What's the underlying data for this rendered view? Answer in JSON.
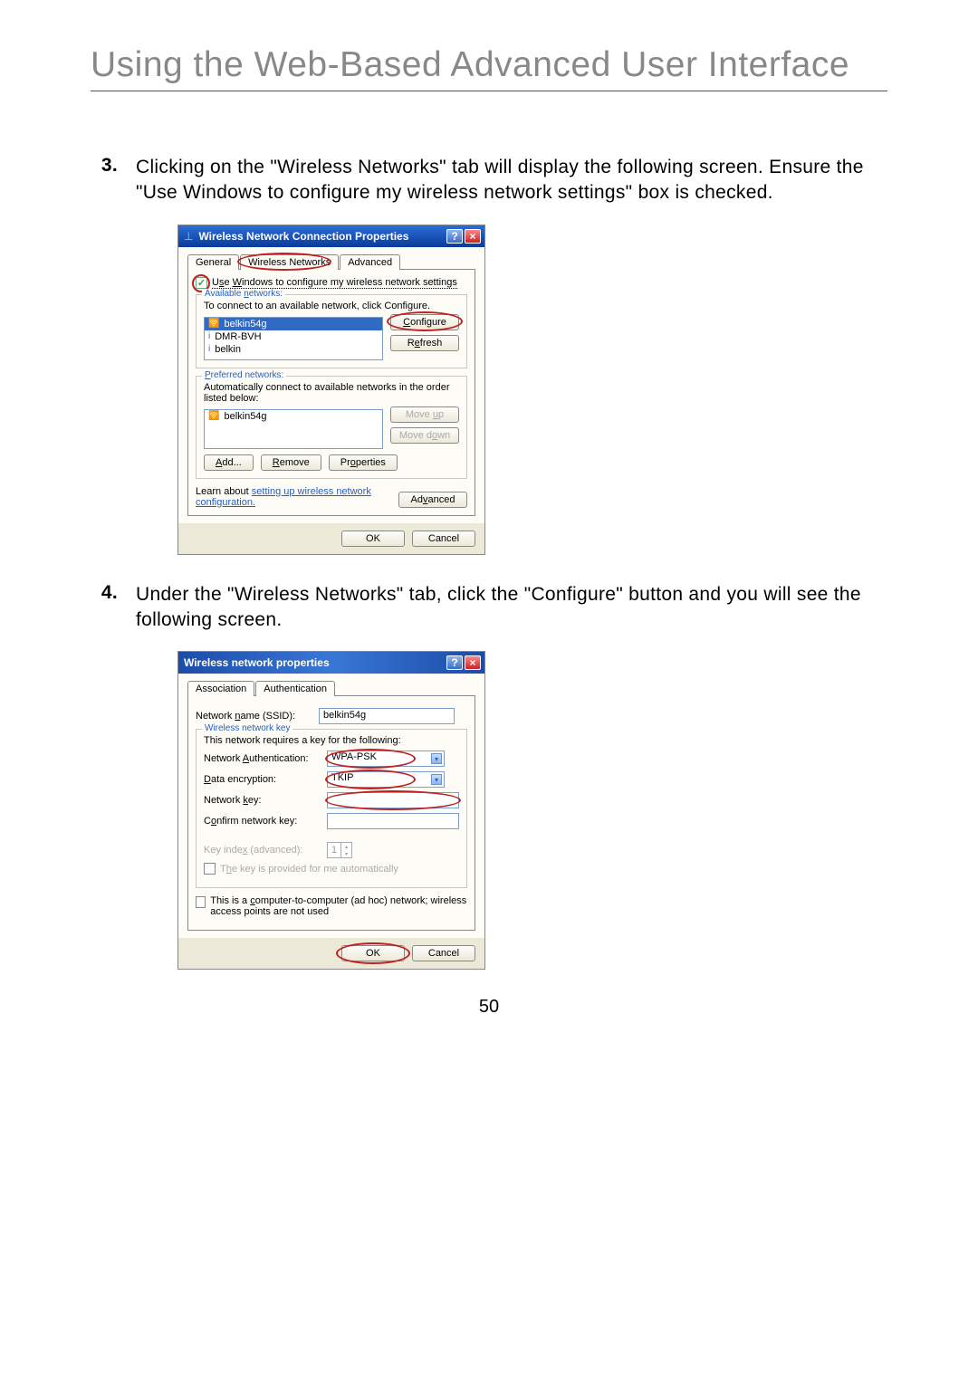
{
  "page_title": "Using the Web-Based Advanced User Interface",
  "step3": {
    "num": "3.",
    "text": "Clicking on the \"Wireless Networks\" tab will display the following screen. Ensure the \"Use Windows to configure my wireless network settings\" box is checked."
  },
  "step4": {
    "num": "4.",
    "text": "Under the \"Wireless Networks\" tab, click the \"Configure\" button and you will see the following screen."
  },
  "dialog1": {
    "title": "Wireless Network Connection Properties",
    "tabs": {
      "general": "General",
      "wireless": "Wireless Networks",
      "advanced": "Advanced"
    },
    "use_windows_label": "Use Windows to configure my wireless network settings",
    "available_legend": "Available networks:",
    "available_hint": "To connect to an available network, click Configure.",
    "available_items": [
      "belkin54g",
      "DMR-BVH",
      "belkin"
    ],
    "configure_btn": "Configure",
    "refresh_btn": "Refresh",
    "preferred_legend": "Preferred networks:",
    "preferred_hint": "Automatically connect to available networks in the order listed below:",
    "preferred_items": [
      "belkin54g"
    ],
    "move_up": "Move up",
    "move_down": "Move down",
    "add": "Add...",
    "remove": "Remove",
    "properties": "Properties",
    "learn_text": "Learn about ",
    "learn_link": "setting up wireless network configuration.",
    "advanced_btn": "Advanced",
    "ok": "OK",
    "cancel": "Cancel"
  },
  "dialog2": {
    "title": "Wireless network properties",
    "tabs": {
      "association": "Association",
      "authentication": "Authentication"
    },
    "ssid_label": "Network name (SSID):",
    "ssid_value": "belkin54g",
    "key_legend": "Wireless network key",
    "key_hint": "This network requires a key for the following:",
    "auth_label": "Network Authentication:",
    "auth_value": "WPA-PSK",
    "enc_label": "Data encryption:",
    "enc_value": "TKIP",
    "netkey_label": "Network key:",
    "confirm_label": "Confirm network key:",
    "keyindex_label": "Key index (advanced):",
    "keyindex_value": "1",
    "auto_label": "The key is provided for me automatically",
    "adhoc_label": "This is a computer-to-computer (ad hoc) network; wireless access points are not used",
    "ok": "OK",
    "cancel": "Cancel"
  },
  "page_number": "50"
}
